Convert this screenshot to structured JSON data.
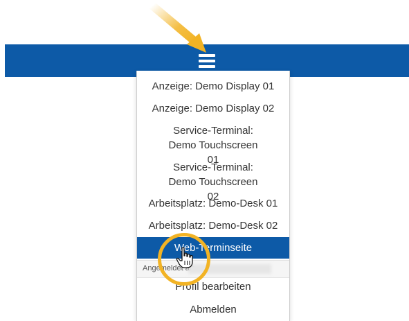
{
  "header": {
    "bar_color": "#0d5aa7",
    "menu_icon": "hamburger-icon"
  },
  "annotation": {
    "arrow_color": "#f2b324",
    "ring_color": "#f2b324"
  },
  "menu": {
    "items": [
      {
        "label": "Anzeige: Demo Display 01"
      },
      {
        "label": "Anzeige: Demo Display 02"
      },
      {
        "label": "Service-Terminal: Demo Touchscreen 01"
      },
      {
        "label": "Service-Terminal: Demo Touchscreen 02"
      },
      {
        "label": "Arbeitsplatz: Demo-Desk 01"
      },
      {
        "label": "Arbeitsplatz: Demo-Desk 02"
      },
      {
        "label": "Web-Terminseite"
      }
    ],
    "active_index": 6,
    "logged_in_label": "Angemeldet als",
    "profile_label": "Profil bearbeiten",
    "logout_label": "Abmelden"
  }
}
